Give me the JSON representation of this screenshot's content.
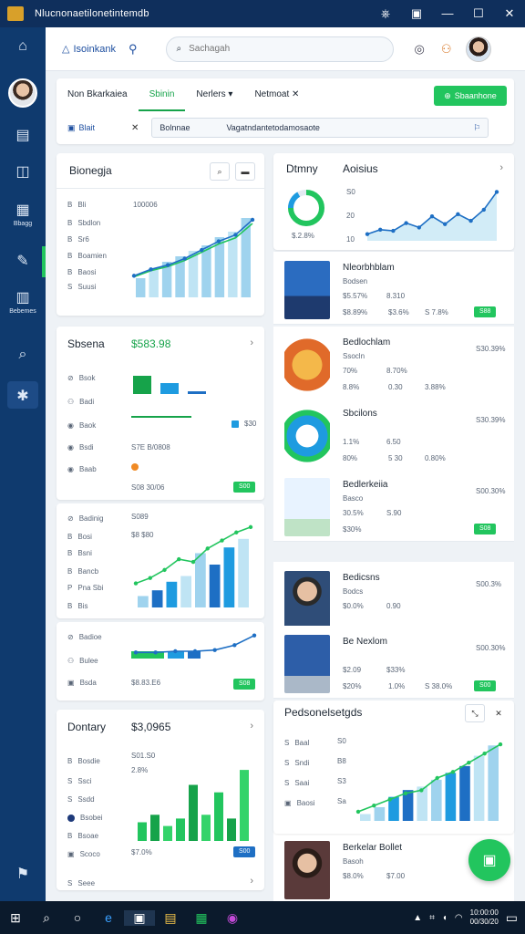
{
  "window": {
    "title": "Nlucnonaetilonetintemdb",
    "controls": [
      "⎈",
      "▣",
      "—",
      "☐",
      "✕"
    ]
  },
  "rail": {
    "items": [
      {
        "icon": "home-icon",
        "glyph": "⌂",
        "label": ""
      },
      {
        "icon": "document-icon",
        "glyph": "▤",
        "label": ""
      },
      {
        "icon": "layout-icon",
        "glyph": "◫",
        "label": ""
      },
      {
        "icon": "calendar-icon",
        "glyph": "▦",
        "label": "Bbagg"
      },
      {
        "icon": "edit-icon",
        "glyph": "✎",
        "label": ""
      },
      {
        "icon": "grid-icon",
        "glyph": "▥",
        "label": "Bebemes"
      },
      {
        "icon": "search-people-icon",
        "glyph": "⌕",
        "label": ""
      },
      {
        "icon": "settings-icon",
        "glyph": "✱",
        "label": ""
      },
      {
        "icon": "help-icon",
        "glyph": "⚑",
        "label": ""
      }
    ]
  },
  "topnav": {
    "brand": "Isoinkank",
    "search_placeholder": "Sachagah"
  },
  "filters": {
    "tabs": [
      "Non Bkarkaiea",
      "Sbinin",
      "Nerlers",
      "Netmoat"
    ],
    "tab_suffix": {
      "nerlers": "▾",
      "netmoat": "✕"
    },
    "action_button": "Sbaanhone",
    "chip": "Blait",
    "input_left": "Bolnnae",
    "input_value": "Vagatndantetodamosaote"
  },
  "cards": {
    "c1": {
      "title": "Bionegja",
      "header_value": "100006",
      "rows": [
        "Bli",
        "Sbdlon",
        "Sr6",
        "Boamien",
        "Baosi",
        "Suusi"
      ],
      "row_prefix": [
        "B",
        "B",
        "B",
        "B",
        "B",
        "S"
      ],
      "chart_bars": [
        14,
        20,
        26,
        30,
        34,
        38,
        44,
        48,
        58
      ],
      "chart_line": [
        20,
        26,
        30,
        36,
        44,
        52,
        58,
        72
      ]
    },
    "c2": {
      "title": "Sbsena",
      "header_value": "$583.98",
      "rows": [
        "Bsok",
        "Badi",
        "Baok",
        "Bsdi",
        "Baab"
      ],
      "bars": [
        20,
        12,
        3
      ],
      "tag": "$30",
      "tag2": "S7E B/0808",
      "tag3": "S08 30/06",
      "pill": "S00"
    },
    "c3": {
      "rows": [
        "Badinig",
        "Bosi",
        "Bsni",
        "Bancb",
        "Pna Sbi",
        "Bis"
      ],
      "v1": "S089",
      "v2": "$8 $80",
      "bars": [
        8,
        12,
        18,
        22,
        38,
        30,
        42,
        48
      ],
      "line": [
        18,
        22,
        28,
        36,
        34,
        44,
        50,
        56,
        60
      ]
    },
    "c4": {
      "rows": [
        "Badioe",
        "Bulee",
        "Bsda"
      ],
      "v1": "$8.83.E6",
      "pill": "S08"
    },
    "c5": {
      "title": "Dontary",
      "header_value": "$3,0965",
      "rows": [
        "Bosdie",
        "Ssci",
        "Ssdd",
        "Bsobei",
        "Bsoae",
        "Scoco",
        "Seee"
      ],
      "v1": "S01.S0",
      "v2": "2.8%",
      "v3": "$7.0%",
      "pill": "S00",
      "bars": [
        10,
        14,
        8,
        12,
        30,
        14,
        26,
        12,
        38
      ]
    },
    "r1": {
      "title": "Dtmny",
      "subtitle": "Aoisius",
      "ring_value": "$.2.8%",
      "ylabels": [
        "S0",
        "20",
        "10"
      ],
      "line": [
        6,
        10,
        9,
        16,
        12,
        22,
        15,
        24,
        18,
        28,
        44
      ]
    },
    "r6": {
      "title": "Pedsonelsetgds",
      "ylabels": [
        "S0",
        "B8",
        "S3",
        "Sa"
      ],
      "bars": [
        4,
        8,
        14,
        18,
        20,
        24,
        28,
        32,
        38,
        44
      ],
      "line": [
        6,
        10,
        14,
        18,
        20,
        28,
        32,
        38,
        44,
        50
      ],
      "rows": [
        "Baal",
        "Sndi",
        "Saai",
        "Baosi"
      ]
    }
  },
  "list": [
    {
      "title": "Nleorbhblam",
      "sub": "Bodsen",
      "a": "$5.57%",
      "b": "8.310",
      "c": "$8.89%",
      "d": "$3.6%",
      "e": "S 7.8%",
      "pill": "S88"
    },
    {
      "title": "Bedlochlam",
      "sub": "Ssocln",
      "a": "70%",
      "b": "8.70%",
      "c": "8.8%",
      "d": "0.30",
      "e": "3.88%",
      "right": "S30.39%"
    },
    {
      "title": "Sbcilons",
      "sub": "",
      "a": "1.1%",
      "b": "6.50",
      "c": "80%",
      "d": "5 30",
      "e": "0.80%",
      "right": "S30.39%"
    },
    {
      "title": "Bedlerkeiia",
      "sub": "Basco",
      "a": "30.5%",
      "b": "S.90",
      "c": "$30%",
      "right": "S00.30%",
      "pill": "S08"
    },
    {
      "title": "Bedicsns",
      "sub": "Bodcs",
      "a": "$0.0%",
      "b": "0.90",
      "right": "S00.3%"
    },
    {
      "title": "Be Nexlom",
      "sub": "",
      "a": "$2.09",
      "b": "$33%",
      "c": "$20%",
      "d": "1.0%",
      "e": "S 38.0%",
      "right": "S00.30%",
      "pill": "S00"
    },
    {
      "title": "Berkelar Bollet",
      "sub": "Basoh",
      "a": "$8.0%",
      "b": "$7.00"
    }
  ],
  "taskbar": {
    "time": "10:00:00",
    "date": "00/30/20"
  },
  "colors": {
    "accent_green": "#22c55e",
    "nav_blue": "#0f3a6e",
    "chart_blue": "#1e6fc4"
  }
}
